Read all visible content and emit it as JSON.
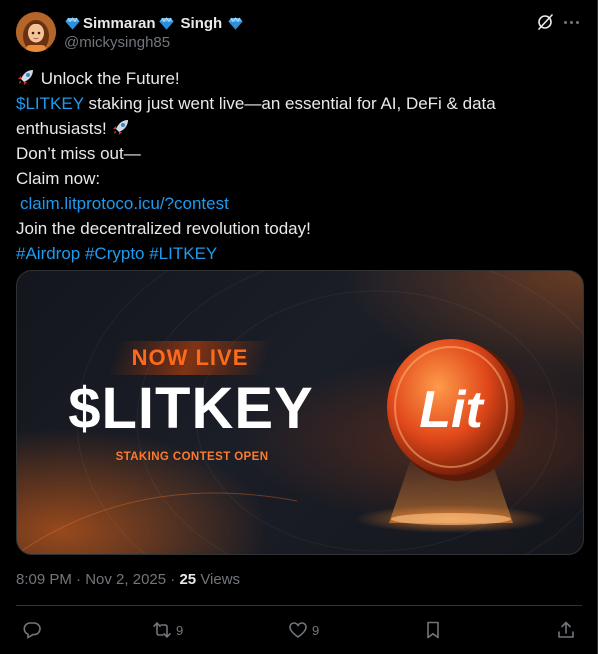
{
  "author": {
    "display_name_parts": [
      "Simmaran",
      "Singh"
    ],
    "handle": "@mickysingh85",
    "badge_icon": "blue-gem-icon"
  },
  "tweet": {
    "line1": "Unlock the Future!",
    "line2_link": "$LITKEY",
    "line2_rest": " staking just went live—an essential for AI, DeFi & data",
    "line3": "enthusiasts!",
    "line4": "Don’t miss out—",
    "line5": "Claim now:",
    "line6_link": "claim.litprotoco.icu/?contest",
    "line7": "Join the decentralized revolution today!",
    "line8_hashtags": "#Airdrop #Crypto #LITKEY",
    "emoji": "rocket-icon"
  },
  "media": {
    "badge": "NOW LIVE",
    "token": "$LITKEY",
    "caption": "STAKING CONTEST OPEN",
    "coin_text": "Lit",
    "accent": "#ff6a1a"
  },
  "meta": {
    "time": "8:09 PM",
    "date": "Nov 2, 2025",
    "views_count": "25",
    "views_label": "Views"
  },
  "actions": {
    "replies": "",
    "reposts": "9",
    "likes": "9"
  },
  "colors": {
    "link": "#1d9bf0",
    "text": "#e7e9ea",
    "muted": "#71767b",
    "background": "#000000"
  }
}
